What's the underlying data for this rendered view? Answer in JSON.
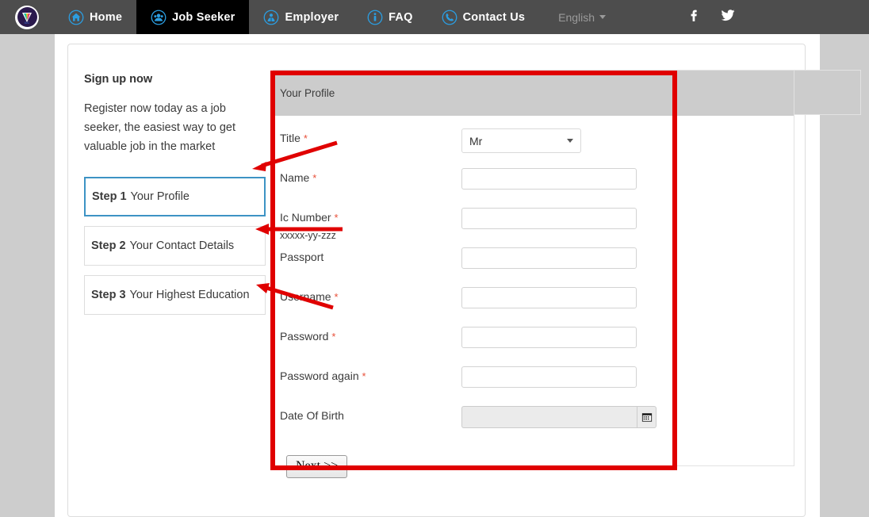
{
  "navbar": {
    "logo_alt": "company-logo",
    "items": [
      {
        "label": "Home",
        "icon": "home-icon",
        "active": false
      },
      {
        "label": "Job Seeker",
        "icon": "job-seeker-icon",
        "active": true
      },
      {
        "label": "Employer",
        "icon": "employer-icon",
        "active": false
      },
      {
        "label": "FAQ",
        "icon": "info-icon",
        "active": false
      },
      {
        "label": "Contact Us",
        "icon": "phone-icon",
        "active": false
      }
    ],
    "language": "English",
    "social": [
      {
        "name": "facebook-icon",
        "glyph": "f"
      },
      {
        "name": "twitter-icon",
        "glyph": "twitter"
      }
    ]
  },
  "sidebar": {
    "title": "Sign up now",
    "description": "Register now today as a job seeker, the easiest way to get valuable job in the market",
    "steps": [
      {
        "num": "Step 1",
        "label": "Your Profile",
        "current": true
      },
      {
        "num": "Step 2",
        "label": "Your Contact Details",
        "current": false
      },
      {
        "num": "Step 3",
        "label": "Your Highest Education",
        "current": false
      }
    ]
  },
  "form": {
    "panel_title": "Your Profile",
    "fields": [
      {
        "label": "Title",
        "required": true,
        "type": "select",
        "value": "Mr",
        "hint": ""
      },
      {
        "label": "Name",
        "required": true,
        "type": "text",
        "value": "",
        "hint": ""
      },
      {
        "label": "Ic Number",
        "required": true,
        "type": "text",
        "value": "",
        "hint": "xxxxx-yy-zzz"
      },
      {
        "label": "Passport",
        "required": false,
        "type": "text",
        "value": "",
        "hint": ""
      },
      {
        "label": "Username",
        "required": true,
        "type": "text",
        "value": "",
        "hint": ""
      },
      {
        "label": "Password",
        "required": true,
        "type": "text",
        "value": "",
        "hint": ""
      },
      {
        "label": "Password again",
        "required": true,
        "type": "text",
        "value": "",
        "hint": ""
      },
      {
        "label": "Date Of Birth",
        "required": false,
        "type": "date",
        "value": "",
        "hint": ""
      }
    ],
    "required_marker": "*",
    "next_button": "Next >>",
    "calendar_icon": "calendar-icon"
  },
  "colors": {
    "navbar_bg": "#4d4d4d",
    "navbar_active_bg": "#000000",
    "icon_blue": "#2b9de0",
    "page_bg": "#cdcdcd",
    "panel_head_bg": "#cccccc",
    "required_red": "#e8503a",
    "annotation_red": "#e00000",
    "step_active_border": "#3d93c4"
  },
  "annotations": {
    "type": "red-highlight-box-and-arrows",
    "box_label": "form-panel-highlight",
    "arrow_count": 3
  }
}
